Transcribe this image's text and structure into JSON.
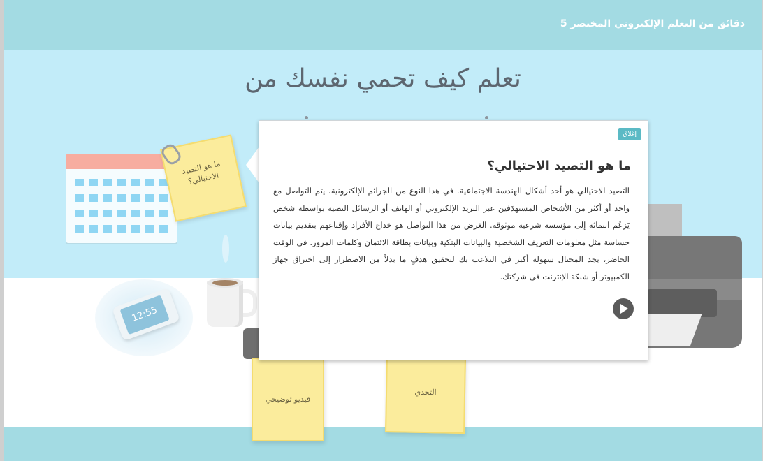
{
  "header": {
    "course_title": "دقائق من التعلم الإلكتروني المختصر 5"
  },
  "scene": {
    "heading": "تعلم كيف تحمي نفسك من",
    "phone_time": "12:55",
    "notes": {
      "top": "ما هو التصيد الاحتيالي؟",
      "video": "فيديو توضيحي",
      "challenge": "التحدي"
    }
  },
  "popup": {
    "close_label": "إغلاق",
    "title": "ما هو التصيد الاحتيالي؟",
    "body": "التصيد الاحتيالي هو أحد أشكال الهندسة الاجتماعية. في هذا النوع من الجرائم الإلكترونية، يتم التواصل مع واحد أو أكثر من الأشخاص المستهدَفين عبر البريد الإلكتروني أو الهاتف أو الرسائل النصية بواسطة شخص يَزعُم انتمائه إلى مؤسسة شرعية موثوقة. الغرض من هذا التواصل هو خداع الأفراد وإقناعهم بتقديم بيانات حساسة مثل معلومات التعريف الشخصية والبيانات البنكية وبيانات بطاقة الائتمان وكلمات المرور. في الوقت الحاضر، يجد المحتال سهولة أكبر في التلاعب بك لتحقيق هدفٍ ما بدلاً من الاضطرار إلى اختراق جهاز الكمبيوتر أو شبكة الإنترنت في شركتك."
  }
}
